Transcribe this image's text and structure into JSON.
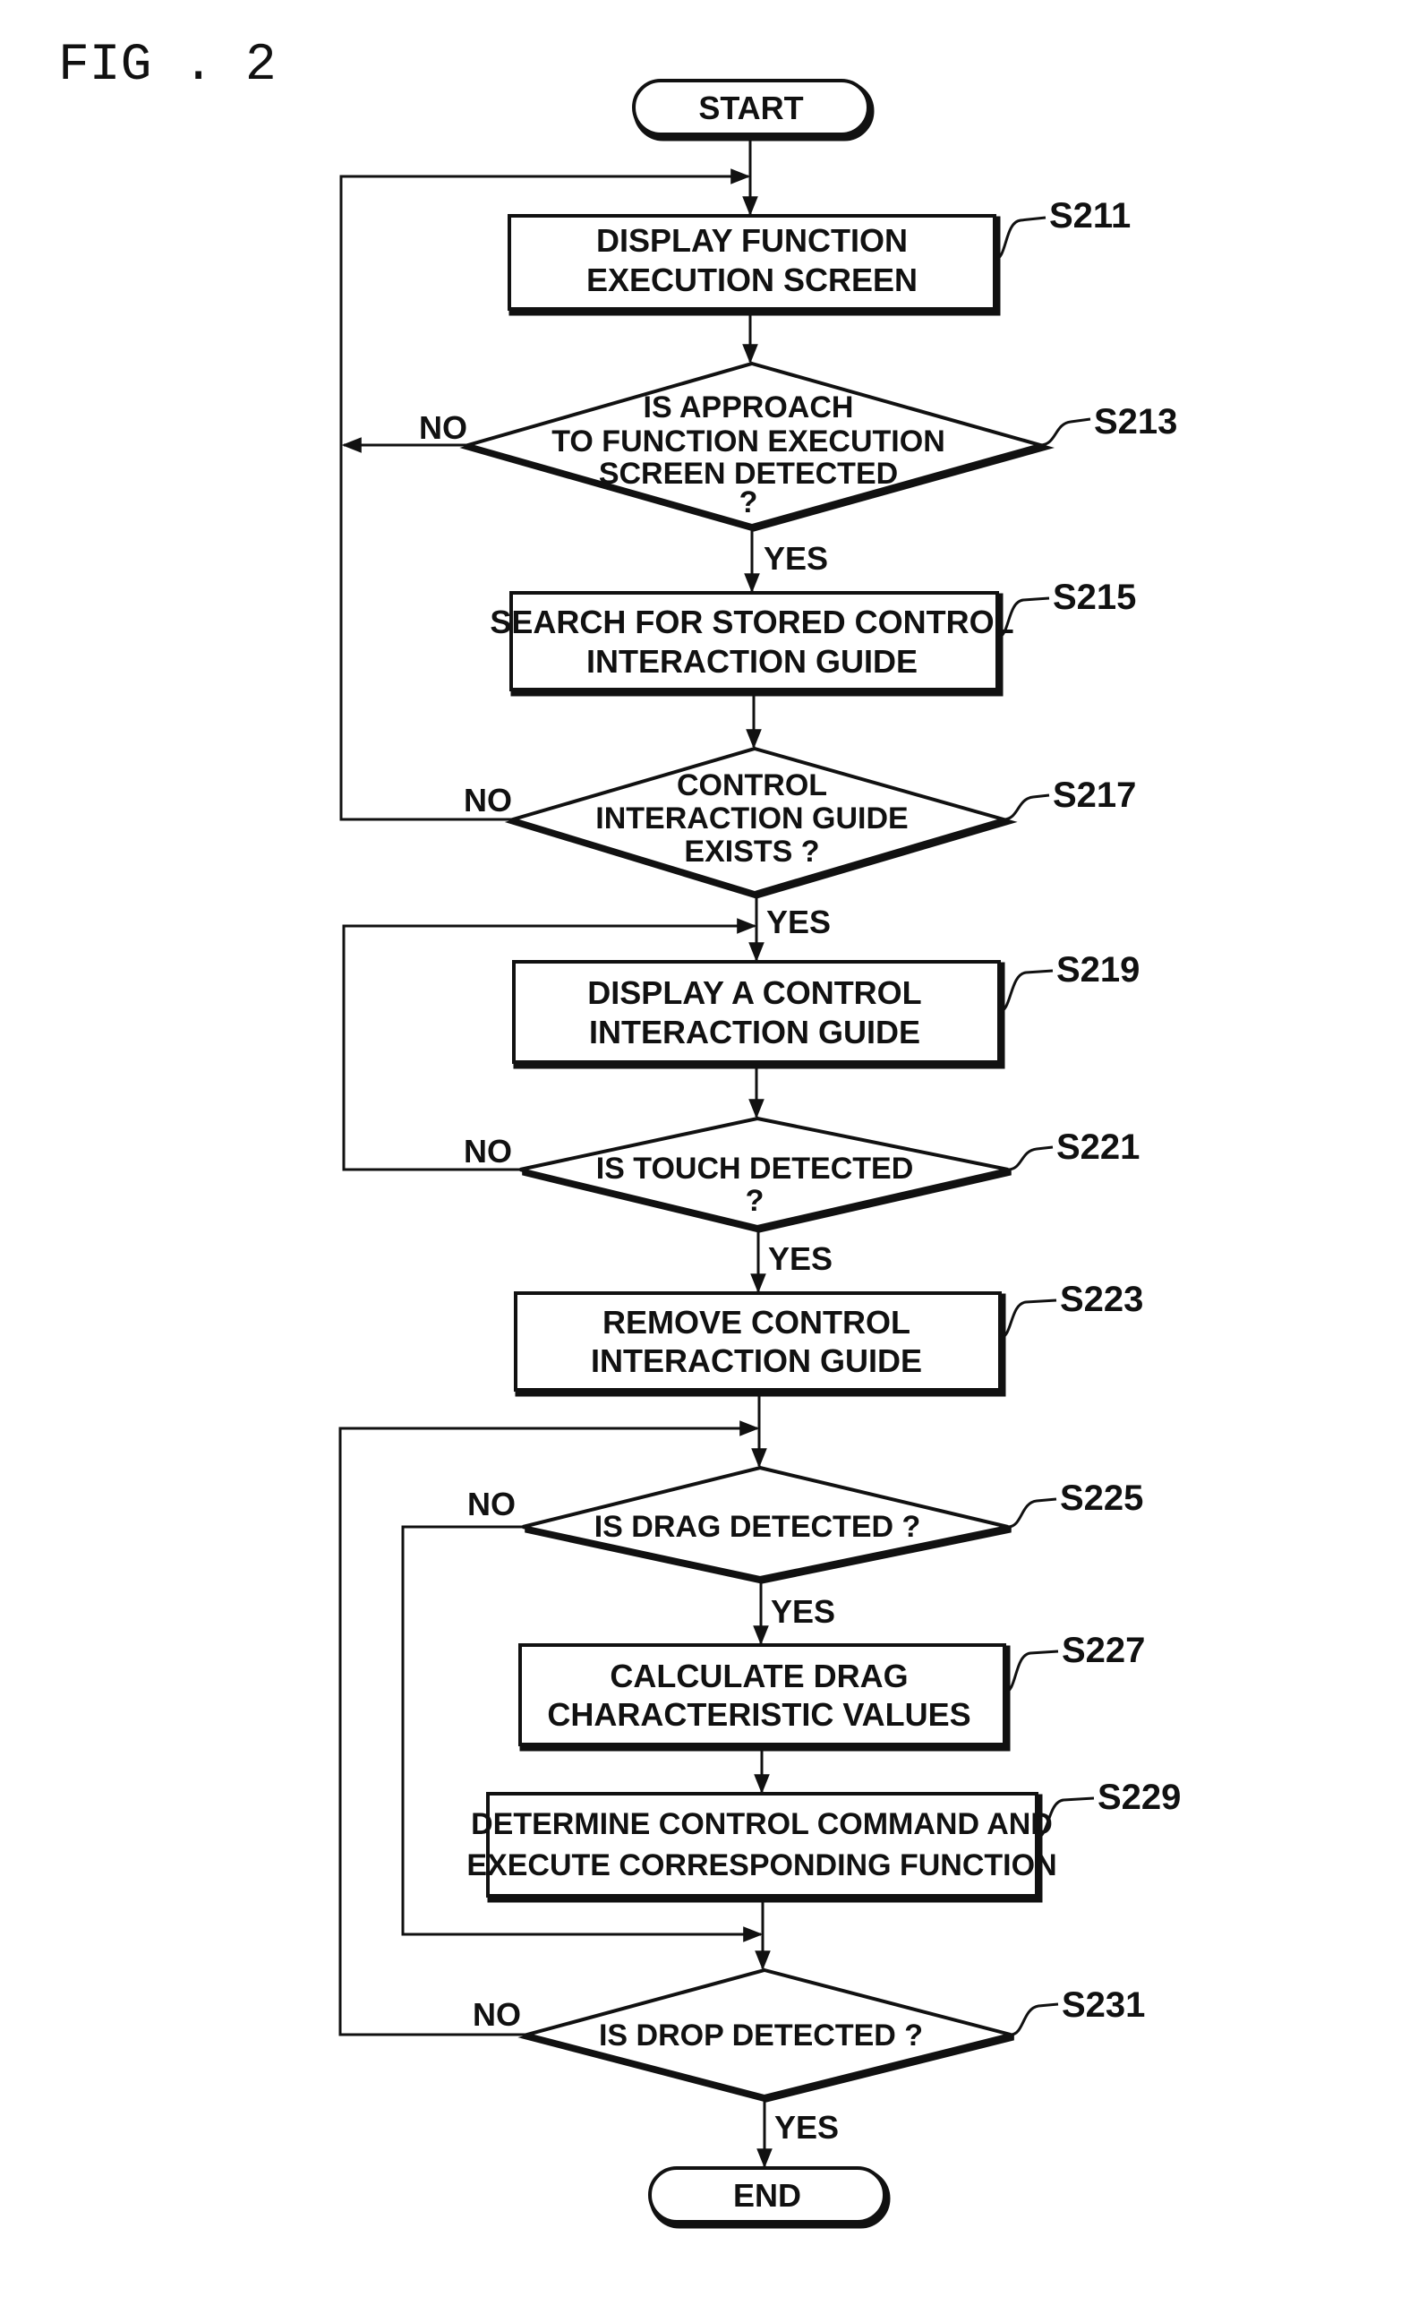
{
  "figure": {
    "title": "FIG . 2"
  },
  "flowchart": {
    "start": {
      "label": "START"
    },
    "end": {
      "label": "END"
    },
    "steps": [
      {
        "id": "S211",
        "type": "process",
        "lines": [
          "DISPLAY FUNCTION",
          "EXECUTION SCREEN"
        ]
      },
      {
        "id": "S213",
        "type": "decision",
        "lines": [
          "IS APPROACH",
          "TO FUNCTION EXECUTION",
          "SCREEN DETECTED",
          "?"
        ],
        "yes": "S215",
        "no": "S211"
      },
      {
        "id": "S215",
        "type": "process",
        "lines": [
          "SEARCH FOR STORED CONTROL",
          "INTERACTION GUIDE"
        ]
      },
      {
        "id": "S217",
        "type": "decision",
        "lines": [
          "CONTROL",
          "INTERACTION GUIDE",
          "EXISTS ?"
        ],
        "yes": "S219",
        "no": "S211"
      },
      {
        "id": "S219",
        "type": "process",
        "lines": [
          "DISPLAY A CONTROL",
          "INTERACTION GUIDE"
        ]
      },
      {
        "id": "S221",
        "type": "decision",
        "lines": [
          "IS TOUCH DETECTED",
          "?"
        ],
        "yes": "S223",
        "no": "S219"
      },
      {
        "id": "S223",
        "type": "process",
        "lines": [
          "REMOVE CONTROL",
          "INTERACTION GUIDE"
        ]
      },
      {
        "id": "S225",
        "type": "decision",
        "lines": [
          "IS DRAG DETECTED ?"
        ],
        "yes": "S227",
        "no": "S231"
      },
      {
        "id": "S227",
        "type": "process",
        "lines": [
          "CALCULATE DRAG",
          "CHARACTERISTIC VALUES"
        ]
      },
      {
        "id": "S229",
        "type": "process",
        "lines": [
          "DETERMINE CONTROL COMMAND AND",
          "EXECUTE CORRESPONDING FUNCTION"
        ]
      },
      {
        "id": "S231",
        "type": "decision",
        "lines": [
          "IS DROP DETECTED ?"
        ],
        "yes": "END",
        "no": "S225"
      }
    ],
    "branch_labels": {
      "yes": "YES",
      "no": "NO"
    }
  }
}
